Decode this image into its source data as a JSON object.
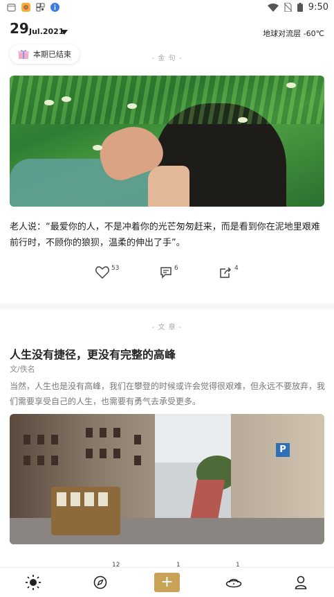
{
  "status_bar": {
    "time": "9:50",
    "icons_left": [
      "calendar-icon",
      "app-icon",
      "qr-icon",
      "info-icon"
    ],
    "icons_right": [
      "wifi-icon",
      "no-sim-icon",
      "battery-icon"
    ]
  },
  "header": {
    "day": "29",
    "month_year": "Jul.2021",
    "weather": "地球对流层 -60℃",
    "pill_label": "本期已结束"
  },
  "quote_section": {
    "label": "- 金 句 -",
    "text": "老人说：“最爱你的人，不是冲着你的光芒匆匆赶来，而是看到你在泥地里艰难前行时，不顾你的狼狈，温柔的伸出了手”。",
    "likes": "53",
    "comments": "6",
    "shares": "4"
  },
  "article_section": {
    "label": "- 文 章 -",
    "title": "人生没有捷径，更没有完整的高峰",
    "author": "文/佚名",
    "excerpt": "当然，人生也是没有高峰，我们在攀登的时候或许会觉得很艰难，但永远不要放弃，我们需要享受自己的人生，也需要有勇气去承受更多。",
    "sign_text": "P",
    "likes": "12",
    "comments": "1",
    "shares": "1"
  },
  "bottom_nav": {
    "items": [
      "sun-icon",
      "compass-icon",
      "plus-icon",
      "ufo-icon",
      "user-icon"
    ],
    "plus_label": "+"
  },
  "colors": {
    "accent": "#c8a256",
    "label_gray": "#aaaaaa"
  }
}
